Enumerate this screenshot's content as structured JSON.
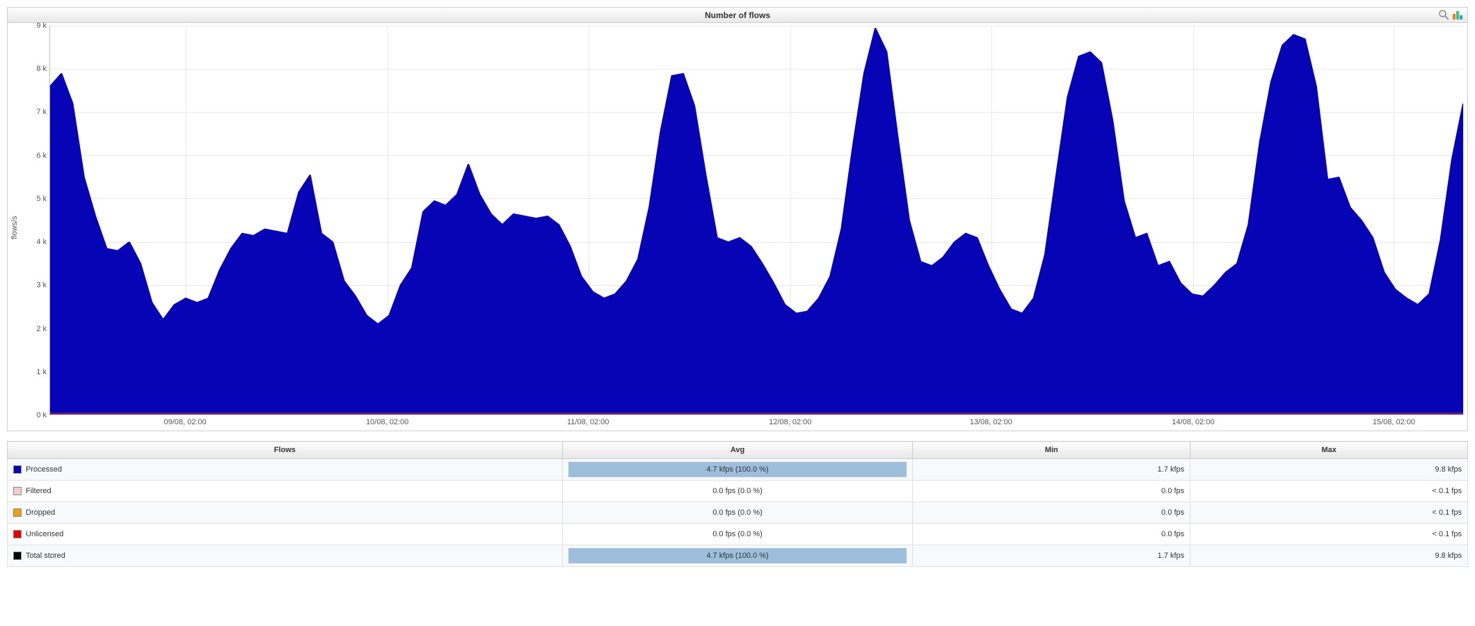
{
  "chart": {
    "title": "Number of flows",
    "ylabel": "flows/s",
    "y_ticks": [
      "0 k",
      "1 k",
      "2 k",
      "3 k",
      "4 k",
      "5 k",
      "6 k",
      "7 k",
      "8 k",
      "9 k"
    ],
    "x_ticks": [
      "09/08, 02:00",
      "10/08, 02:00",
      "11/08, 02:00",
      "12/08, 02:00",
      "13/08, 02:00",
      "14/08, 02:00",
      "15/08, 02:00"
    ],
    "tools": {
      "zoom": "zoom-icon",
      "export": "chart-export-icon"
    }
  },
  "chart_data": {
    "type": "area",
    "title": "Number of flows",
    "xlabel": "",
    "ylabel": "flows/s",
    "ylim": [
      0,
      9000
    ],
    "y_unit": "flows/s",
    "x_range_start": "08/08, 09:00",
    "x_range_end": "15/08, 09:00",
    "x_tick_positions_pct": [
      9.6,
      23.9,
      38.1,
      52.4,
      66.6,
      80.9,
      95.1
    ],
    "x_tick_labels": [
      "09/08, 02:00",
      "10/08, 02:00",
      "11/08, 02:00",
      "12/08, 02:00",
      "13/08, 02:00",
      "14/08, 02:00",
      "15/08, 02:00"
    ],
    "series": [
      {
        "name": "Processed",
        "color": "#0704b5",
        "values": [
          7600,
          7900,
          7200,
          5500,
          4600,
          3850,
          3800,
          4000,
          3500,
          2600,
          2200,
          2550,
          2700,
          2600,
          2700,
          3350,
          3850,
          4200,
          4150,
          4300,
          4250,
          4200,
          5150,
          5550,
          4200,
          4000,
          3100,
          2750,
          2300,
          2100,
          2300,
          3000,
          3400,
          4700,
          4950,
          4850,
          5100,
          5800,
          5100,
          4650,
          4400,
          4650,
          4600,
          4550,
          4600,
          4400,
          3900,
          3200,
          2850,
          2700,
          2800,
          3100,
          3600,
          4800,
          6550,
          7850,
          7900,
          7150,
          5550,
          4100,
          4000,
          4100,
          3900,
          3500,
          3050,
          2550,
          2350,
          2400,
          2700,
          3200,
          4300,
          6200,
          7900,
          8950,
          8400,
          6400,
          4500,
          3550,
          3450,
          3650,
          4000,
          4200,
          4100,
          3450,
          2900,
          2450,
          2350,
          2700,
          3700,
          5550,
          7350,
          8300,
          8400,
          8150,
          6800,
          4950,
          4100,
          4200,
          3450,
          3550,
          3050,
          2800,
          2750,
          3000,
          3300,
          3500,
          4400,
          6300,
          7700,
          8550,
          8800,
          8700,
          7600,
          5450,
          5500,
          4800,
          4500,
          4100,
          3300,
          2900,
          2700,
          2550,
          2800,
          4050,
          5900,
          7200
        ]
      }
    ]
  },
  "table": {
    "headers": [
      "Flows",
      "Avg",
      "Min",
      "Max"
    ],
    "rows": [
      {
        "color": "#0704b5",
        "name": "Processed",
        "avg": "4.7 kfps (100.0 %)",
        "avg_bar_pct": 100,
        "min": "1.7 kfps",
        "max": "9.8 kfps",
        "alt": true
      },
      {
        "color": "#f8c7d0",
        "name": "Filtered",
        "avg": "0.0 fps (0.0 %)",
        "avg_bar_pct": 0,
        "min": "0.0 fps",
        "max": "< 0.1 fps",
        "alt": false
      },
      {
        "color": "#f39c12",
        "name": "Dropped",
        "avg": "0.0 fps (0.0 %)",
        "avg_bar_pct": 0,
        "min": "0.0 fps",
        "max": "< 0.1 fps",
        "alt": true
      },
      {
        "color": "#e60000",
        "name": "Unlicensed",
        "avg": "0.0 fps (0.0 %)",
        "avg_bar_pct": 0,
        "min": "0.0 fps",
        "max": "< 0.1 fps",
        "alt": false
      },
      {
        "color": "#000000",
        "name": "Total stored",
        "avg": "4.7 kfps (100.0 %)",
        "avg_bar_pct": 100,
        "min": "1.7 kfps",
        "max": "9.8 kfps",
        "alt": true
      }
    ]
  }
}
